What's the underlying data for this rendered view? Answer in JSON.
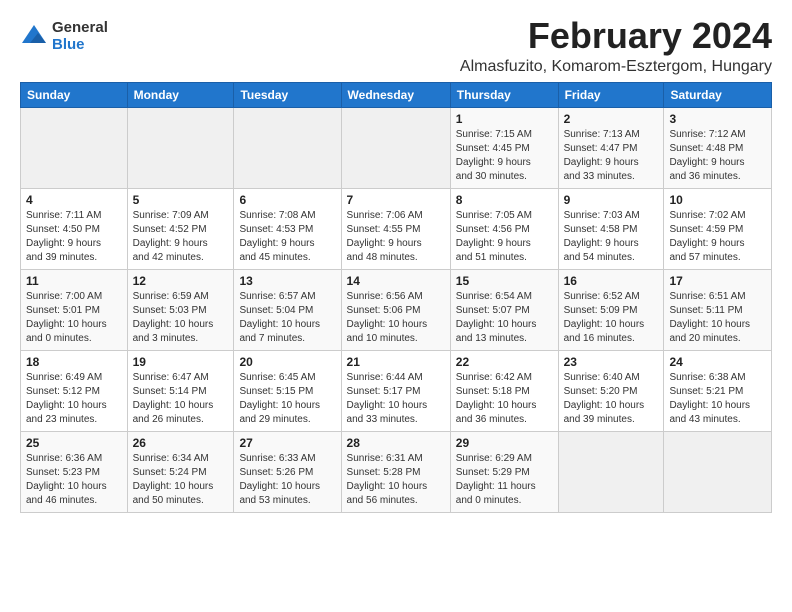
{
  "logo": {
    "general": "General",
    "blue": "Blue"
  },
  "title": {
    "month": "February 2024",
    "location": "Almasfuzito, Komarom-Esztergom, Hungary"
  },
  "weekdays": [
    "Sunday",
    "Monday",
    "Tuesday",
    "Wednesday",
    "Thursday",
    "Friday",
    "Saturday"
  ],
  "weeks": [
    [
      {
        "day": "",
        "info": ""
      },
      {
        "day": "",
        "info": ""
      },
      {
        "day": "",
        "info": ""
      },
      {
        "day": "",
        "info": ""
      },
      {
        "day": "1",
        "info": "Sunrise: 7:15 AM\nSunset: 4:45 PM\nDaylight: 9 hours\nand 30 minutes."
      },
      {
        "day": "2",
        "info": "Sunrise: 7:13 AM\nSunset: 4:47 PM\nDaylight: 9 hours\nand 33 minutes."
      },
      {
        "day": "3",
        "info": "Sunrise: 7:12 AM\nSunset: 4:48 PM\nDaylight: 9 hours\nand 36 minutes."
      }
    ],
    [
      {
        "day": "4",
        "info": "Sunrise: 7:11 AM\nSunset: 4:50 PM\nDaylight: 9 hours\nand 39 minutes."
      },
      {
        "day": "5",
        "info": "Sunrise: 7:09 AM\nSunset: 4:52 PM\nDaylight: 9 hours\nand 42 minutes."
      },
      {
        "day": "6",
        "info": "Sunrise: 7:08 AM\nSunset: 4:53 PM\nDaylight: 9 hours\nand 45 minutes."
      },
      {
        "day": "7",
        "info": "Sunrise: 7:06 AM\nSunset: 4:55 PM\nDaylight: 9 hours\nand 48 minutes."
      },
      {
        "day": "8",
        "info": "Sunrise: 7:05 AM\nSunset: 4:56 PM\nDaylight: 9 hours\nand 51 minutes."
      },
      {
        "day": "9",
        "info": "Sunrise: 7:03 AM\nSunset: 4:58 PM\nDaylight: 9 hours\nand 54 minutes."
      },
      {
        "day": "10",
        "info": "Sunrise: 7:02 AM\nSunset: 4:59 PM\nDaylight: 9 hours\nand 57 minutes."
      }
    ],
    [
      {
        "day": "11",
        "info": "Sunrise: 7:00 AM\nSunset: 5:01 PM\nDaylight: 10 hours\nand 0 minutes."
      },
      {
        "day": "12",
        "info": "Sunrise: 6:59 AM\nSunset: 5:03 PM\nDaylight: 10 hours\nand 3 minutes."
      },
      {
        "day": "13",
        "info": "Sunrise: 6:57 AM\nSunset: 5:04 PM\nDaylight: 10 hours\nand 7 minutes."
      },
      {
        "day": "14",
        "info": "Sunrise: 6:56 AM\nSunset: 5:06 PM\nDaylight: 10 hours\nand 10 minutes."
      },
      {
        "day": "15",
        "info": "Sunrise: 6:54 AM\nSunset: 5:07 PM\nDaylight: 10 hours\nand 13 minutes."
      },
      {
        "day": "16",
        "info": "Sunrise: 6:52 AM\nSunset: 5:09 PM\nDaylight: 10 hours\nand 16 minutes."
      },
      {
        "day": "17",
        "info": "Sunrise: 6:51 AM\nSunset: 5:11 PM\nDaylight: 10 hours\nand 20 minutes."
      }
    ],
    [
      {
        "day": "18",
        "info": "Sunrise: 6:49 AM\nSunset: 5:12 PM\nDaylight: 10 hours\nand 23 minutes."
      },
      {
        "day": "19",
        "info": "Sunrise: 6:47 AM\nSunset: 5:14 PM\nDaylight: 10 hours\nand 26 minutes."
      },
      {
        "day": "20",
        "info": "Sunrise: 6:45 AM\nSunset: 5:15 PM\nDaylight: 10 hours\nand 29 minutes."
      },
      {
        "day": "21",
        "info": "Sunrise: 6:44 AM\nSunset: 5:17 PM\nDaylight: 10 hours\nand 33 minutes."
      },
      {
        "day": "22",
        "info": "Sunrise: 6:42 AM\nSunset: 5:18 PM\nDaylight: 10 hours\nand 36 minutes."
      },
      {
        "day": "23",
        "info": "Sunrise: 6:40 AM\nSunset: 5:20 PM\nDaylight: 10 hours\nand 39 minutes."
      },
      {
        "day": "24",
        "info": "Sunrise: 6:38 AM\nSunset: 5:21 PM\nDaylight: 10 hours\nand 43 minutes."
      }
    ],
    [
      {
        "day": "25",
        "info": "Sunrise: 6:36 AM\nSunset: 5:23 PM\nDaylight: 10 hours\nand 46 minutes."
      },
      {
        "day": "26",
        "info": "Sunrise: 6:34 AM\nSunset: 5:24 PM\nDaylight: 10 hours\nand 50 minutes."
      },
      {
        "day": "27",
        "info": "Sunrise: 6:33 AM\nSunset: 5:26 PM\nDaylight: 10 hours\nand 53 minutes."
      },
      {
        "day": "28",
        "info": "Sunrise: 6:31 AM\nSunset: 5:28 PM\nDaylight: 10 hours\nand 56 minutes."
      },
      {
        "day": "29",
        "info": "Sunrise: 6:29 AM\nSunset: 5:29 PM\nDaylight: 11 hours\nand 0 minutes."
      },
      {
        "day": "",
        "info": ""
      },
      {
        "day": "",
        "info": ""
      }
    ]
  ]
}
